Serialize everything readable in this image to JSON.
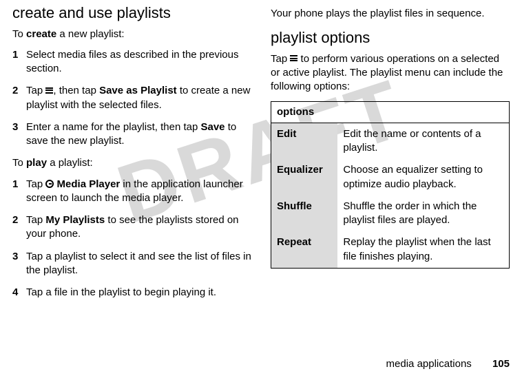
{
  "watermark": "DRAFT",
  "left": {
    "heading": "create and use playlists",
    "intro_prefix": "To ",
    "intro_bold": "create",
    "intro_suffix": " a new playlist:",
    "steps_create": [
      {
        "n": "1",
        "text": "Select media files as described in the previous section."
      },
      {
        "n": "2",
        "pre": "Tap ",
        "mid": ", then tap ",
        "cond": "Save as Playlist",
        "post": " to create a new playlist with the selected files."
      },
      {
        "n": "3",
        "pre": "Enter a name for the playlist, then tap ",
        "cond": "Save",
        "post": " to save the new playlist."
      }
    ],
    "intro2_prefix": "To ",
    "intro2_bold": "play",
    "intro2_suffix": " a playlist:",
    "steps_play": [
      {
        "n": "1",
        "pre": "Tap ",
        "cond": "Media Player",
        "post": " in the application launcher screen to launch the media player."
      },
      {
        "n": "2",
        "pre": "Tap ",
        "cond": "My Playlists",
        "post": " to see the playlists stored on your phone."
      },
      {
        "n": "3",
        "text": "Tap a playlist to select it and see the list of files in the playlist."
      },
      {
        "n": "4",
        "text": "Tap a file in the playlist to begin playing it."
      }
    ]
  },
  "right": {
    "top_para": "Your phone plays the playlist files in sequence.",
    "heading": "playlist options",
    "intro_pre": "Tap ",
    "intro_post": " to perform various operations on a selected or active playlist. The playlist menu can include the following options:",
    "table_heading": "options",
    "table": [
      {
        "name": "Edit",
        "desc": "Edit the name or contents of a playlist."
      },
      {
        "name": "Equalizer",
        "desc": "Choose an equalizer setting to optimize audio playback."
      },
      {
        "name": "Shuffle",
        "desc": "Shuffle the order in which the playlist files are played."
      },
      {
        "name": "Repeat",
        "desc": "Replay the playlist when the last file finishes playing."
      }
    ]
  },
  "footer": {
    "section": "media applications",
    "page": "105"
  }
}
